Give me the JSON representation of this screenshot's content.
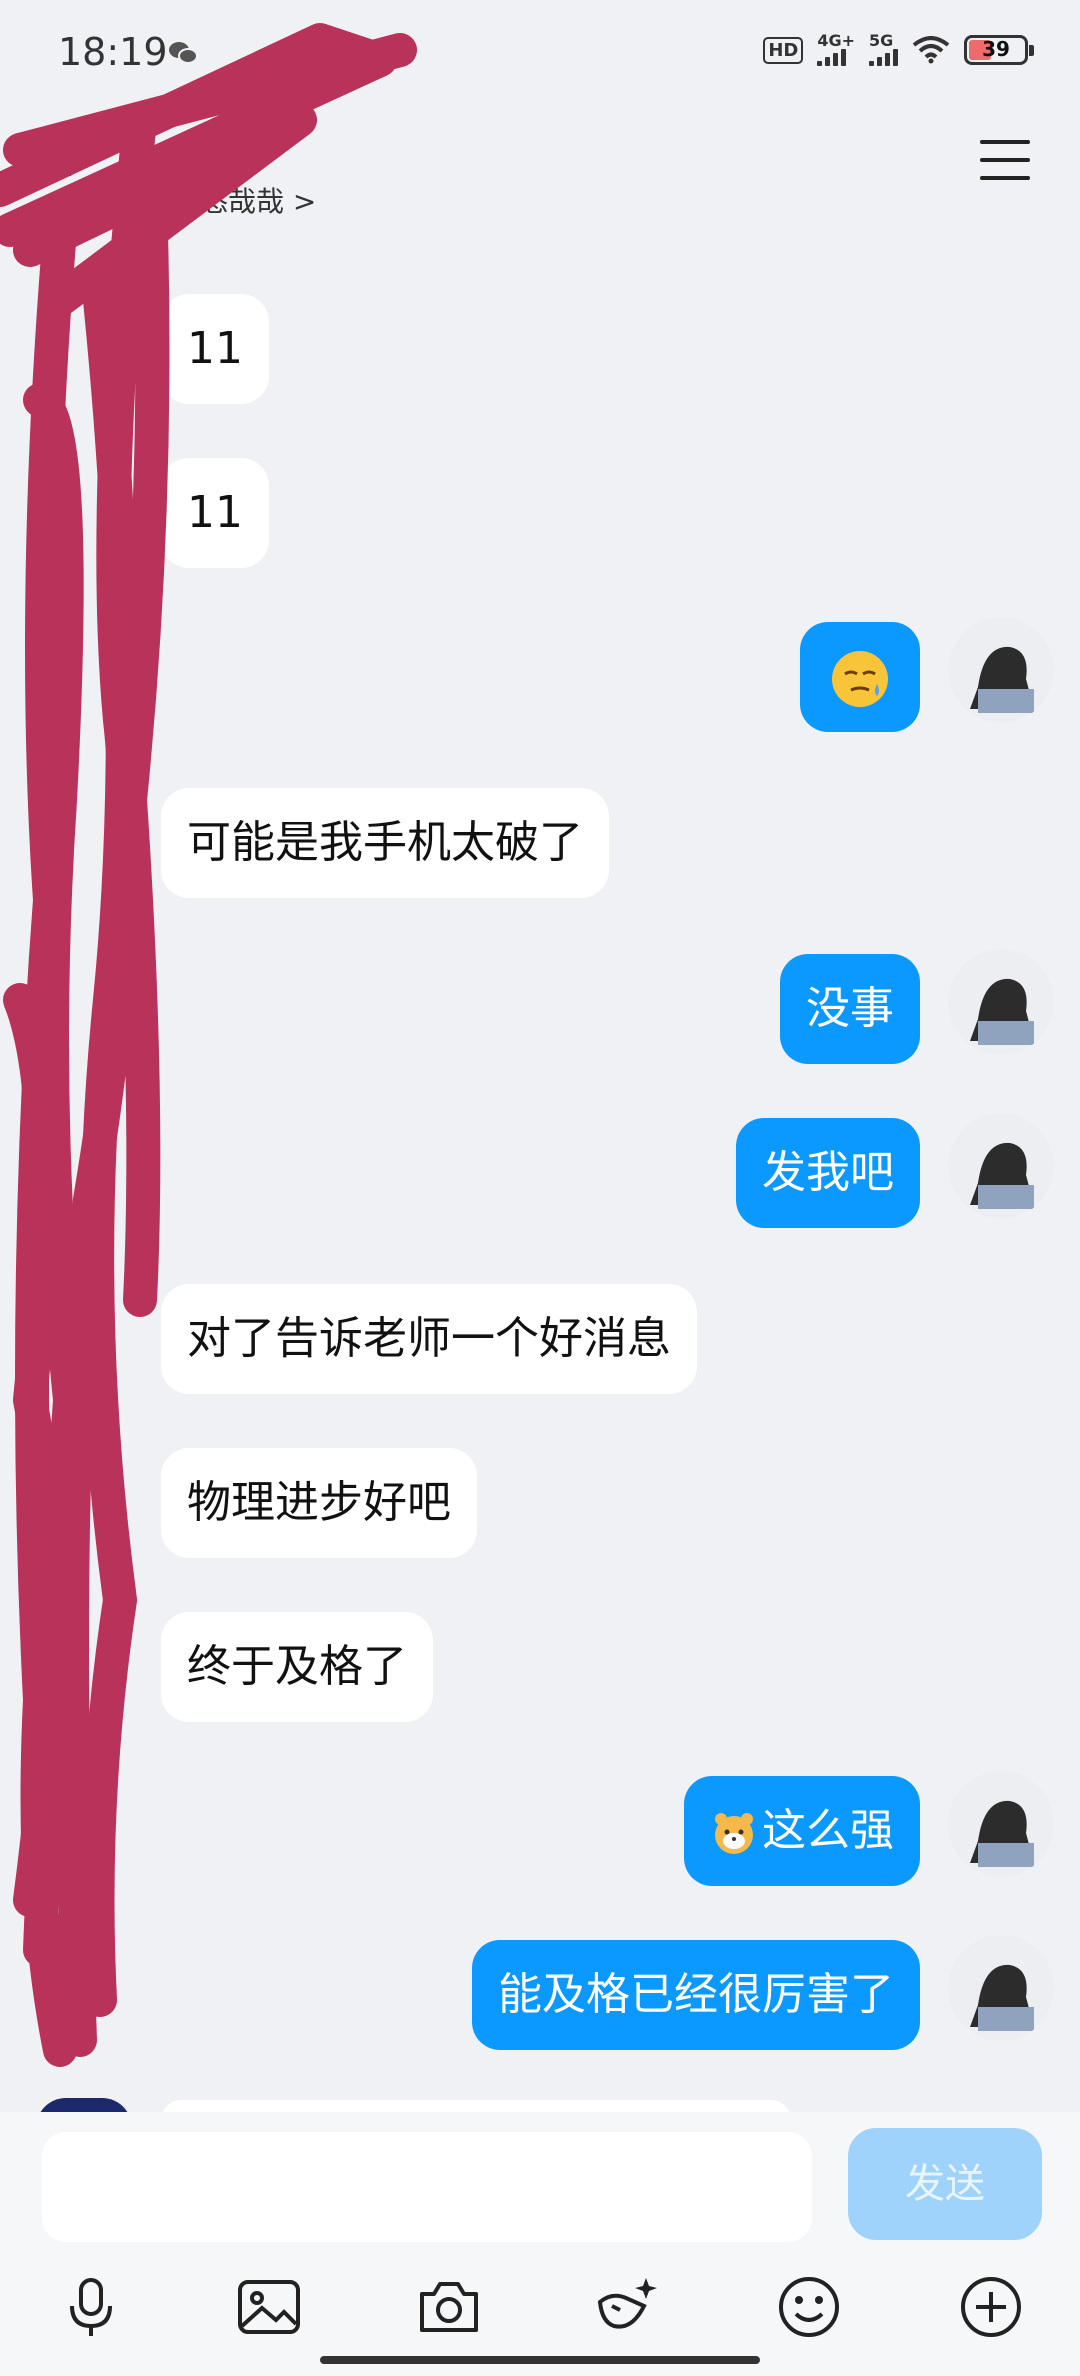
{
  "status_bar": {
    "time": "18:19",
    "battery": "39",
    "network_hd": "HD",
    "network_4g": "4G+",
    "network_5g": "5G"
  },
  "header": {
    "subtitle": "悠哉哉 >"
  },
  "messages": [
    {
      "side": "in",
      "text": "11"
    },
    {
      "side": "in",
      "text": "11"
    },
    {
      "side": "out",
      "text": "",
      "emoji": "sweat-face"
    },
    {
      "side": "in",
      "text": "可能是我手机太破了"
    },
    {
      "side": "out",
      "text": "没事"
    },
    {
      "side": "out",
      "text": "发我吧"
    },
    {
      "side": "in",
      "text": "对了告诉老师一个好消息"
    },
    {
      "side": "in",
      "text": "物理进步好吧"
    },
    {
      "side": "in",
      "text": "终于及格了"
    },
    {
      "side": "out",
      "text": "这么强",
      "emoji": "tiger-face"
    },
    {
      "side": "out",
      "text": "能及格已经很厉害了"
    }
  ],
  "input": {
    "placeholder": "",
    "send_label": "发送"
  },
  "colors": {
    "outgoing_bubble": "#0b99ff",
    "incoming_bubble": "#ffffff",
    "background": "#f0f1f5",
    "send_disabled": "#9fd3fb",
    "scribble": "#b8325a"
  },
  "toolbar_icons": [
    "microphone-icon",
    "image-icon",
    "camera-icon",
    "red-packet-icon",
    "smiley-icon",
    "plus-icon"
  ]
}
